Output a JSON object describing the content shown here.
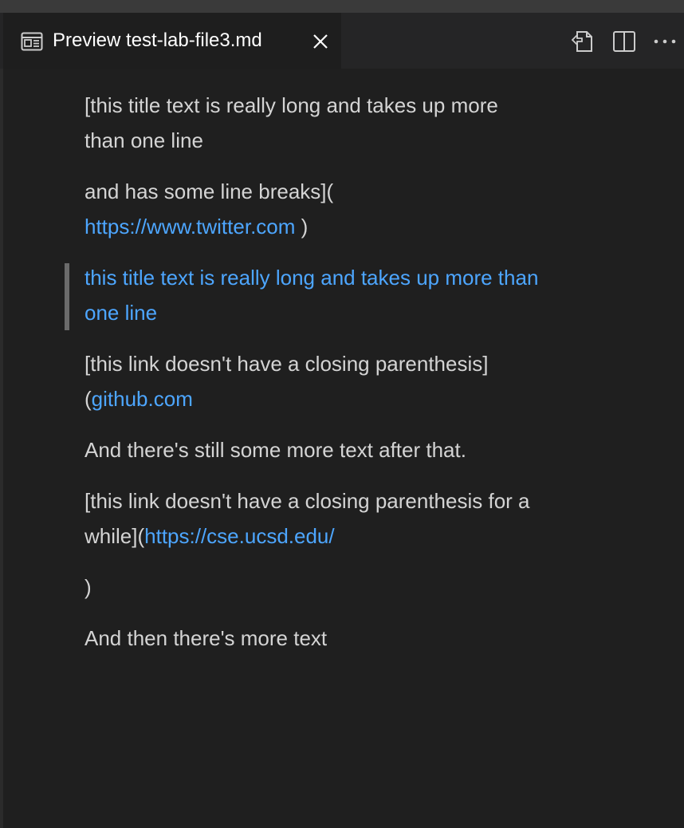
{
  "tab": {
    "title": "Preview test-lab-file3.md"
  },
  "toolbar": {
    "icons": [
      "open-source-icon",
      "split-editor-icon",
      "more-actions-icon"
    ]
  },
  "colors": {
    "link": "#4da6ff",
    "text": "#d4d4d4",
    "background": "#1f1f1f"
  },
  "content": {
    "p1": {
      "line1": "[this title text is really long and takes up more",
      "line2": "than one line"
    },
    "p2": {
      "text": "and has some line breaks](",
      "link": "https://www.twitter.com",
      "suffix": " )"
    },
    "quote": {
      "line1": "this title text is really long and takes up more than",
      "line2": "one line"
    },
    "p3": {
      "text": "[this link doesn't have a closing parenthesis]",
      "prefix": "(",
      "link": "github.com"
    },
    "p4": {
      "text": "And there's still some more text after that."
    },
    "p5": {
      "line1": "[this link doesn't have a closing parenthesis for a",
      "prefix": "while](",
      "link": "https://cse.ucsd.edu/"
    },
    "p6": {
      "text": ")"
    },
    "p7": {
      "text": "And then there's more text"
    }
  }
}
